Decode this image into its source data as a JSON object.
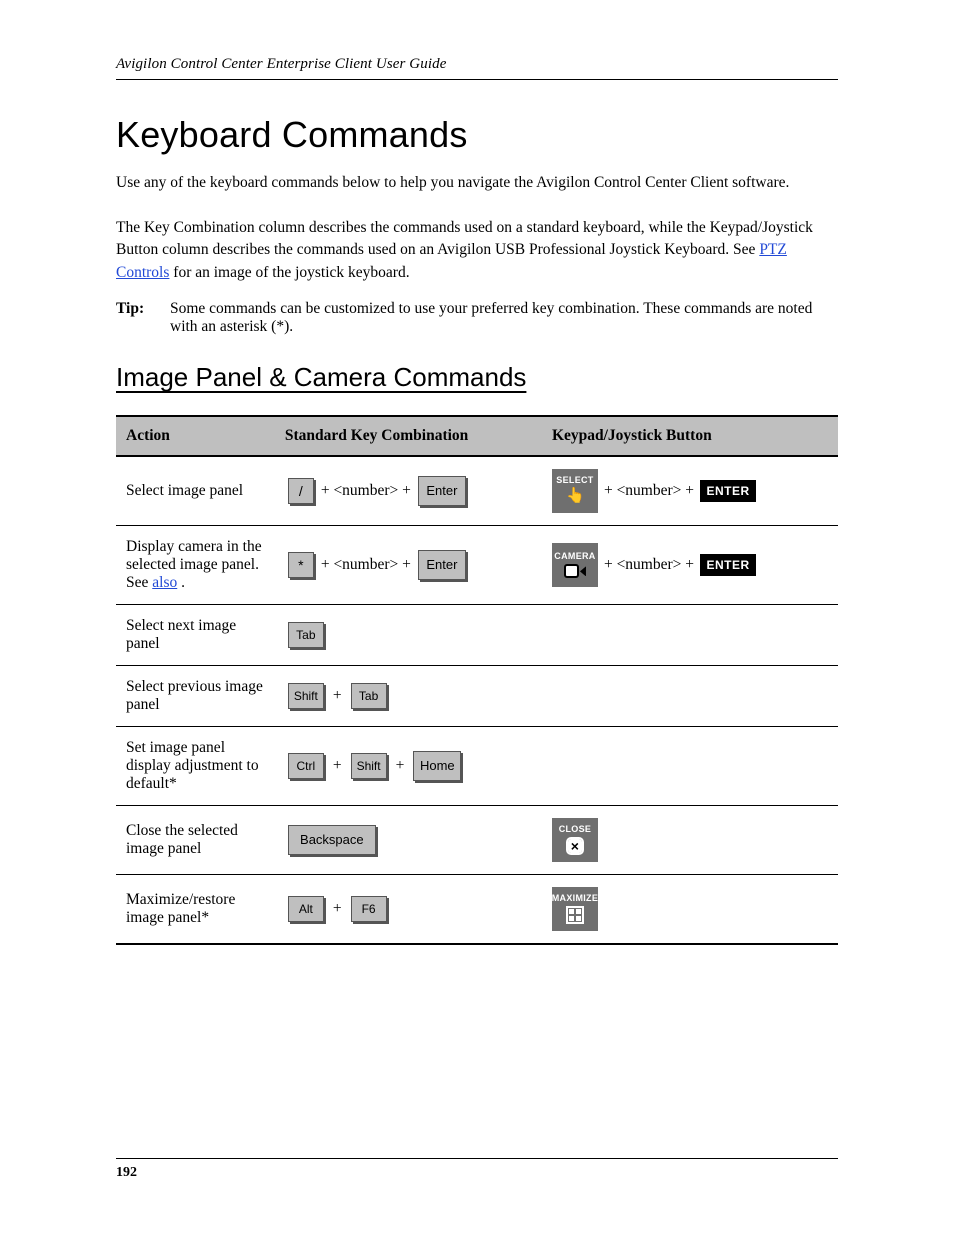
{
  "header": {
    "running_title": "Avigilon Control Center Enterprise Client User Guide"
  },
  "h1": "Keyboard Commands",
  "intro_before_link": "Use any of the keyboard commands below to help you navigate the Avigilon Control Center Client software.\n\nThe Key Combination column describes the commands used on a standard keyboard, while the Keypad/Joystick Button column describes the commands used on an Avigilon USB Professional Joystick Keyboard. See ",
  "intro_link": "PTZ Controls",
  "intro_after_link": " for an image of the joystick keyboard.",
  "tip_label": "Tip:",
  "tip_text": "Some commands can be customized to use your preferred key combination. These commands are noted with an asterisk (*).",
  "h2": "Image Panel & Camera Commands",
  "table": {
    "head": [
      "Action",
      "Standard Key Combination",
      "Keypad/Joystick Button"
    ],
    "rows": [
      {
        "action": "Select image panel",
        "std_pre": "",
        "std_key1": "/",
        "std_mid": " + <number> + ",
        "std_key2": "Enter",
        "std_post": "",
        "joy_btn": "SELECT",
        "joy_icon": "tap",
        "joy_mid": " + <number>  + ",
        "joy_enter": true
      },
      {
        "action_pre": "Display camera in the selected image panel. See ",
        "action_link": "also",
        "action_post": ".",
        "std_pre": "",
        "std_key1": "*",
        "std_mid": " + <number> + ",
        "std_key2": "Enter",
        "std_post": "",
        "joy_btn": "CAMERA",
        "joy_icon": "cam",
        "joy_mid": " + <number> + ",
        "joy_enter": true
      },
      {
        "action": "Select next image panel",
        "std_single_key": "Tab",
        "joy_text": ""
      },
      {
        "action": "Select previous image panel",
        "std_k1": "Shift",
        "std_plus": " + ",
        "std_k2": "Tab",
        "joy_text": ""
      },
      {
        "action": "Set image panel display adjustment to default*",
        "std_k1": "Ctrl",
        "std_plus": " + ",
        "std_k2": "Shift",
        "std_plus2": " + ",
        "std_k3": "Home",
        "joy_text": ""
      },
      {
        "action": "Close the selected image panel",
        "std_long": "Backspace",
        "joy_btn": "CLOSE",
        "joy_icon": "close"
      },
      {
        "action": "Maximize/restore image panel*",
        "std_k1": "Alt",
        "std_plus": " + ",
        "std_k2": "F6",
        "joy_btn": "MAXIMIZE",
        "joy_icon": "max"
      }
    ]
  },
  "footer": {
    "page_number": "192"
  }
}
